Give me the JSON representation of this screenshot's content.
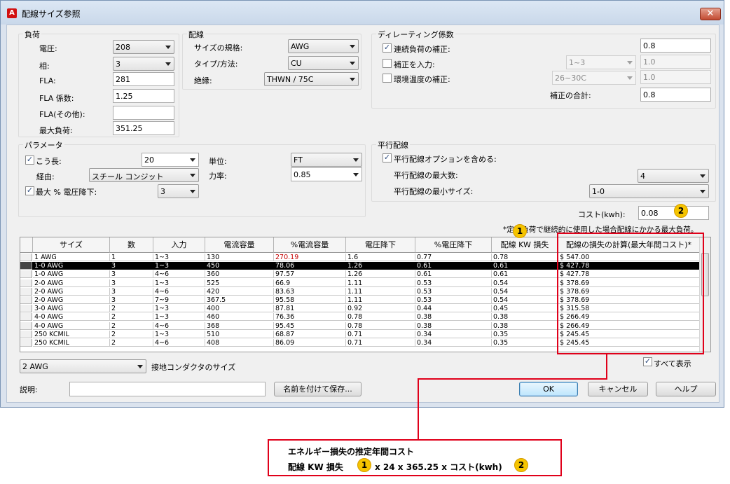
{
  "window": {
    "title": "配線サイズ参照",
    "close_glyph": "✕",
    "app_icon_letter": "A"
  },
  "load": {
    "title": "負荷",
    "voltage_label": "電圧:",
    "voltage_value": "208",
    "phase_label": "相:",
    "phase_value": "3",
    "fla_label": "FLA:",
    "fla_value": "281",
    "fla_factor_label": "FLA 係数:",
    "fla_factor_value": "1.25",
    "fla_other_label": "FLA(その他):",
    "fla_other_value": "",
    "max_load_label": "最大負荷:",
    "max_load_value": "351.25"
  },
  "wiring": {
    "title": "配線",
    "size_std_label": "サイズの規格:",
    "size_std_value": "AWG",
    "type_label": "タイプ/方法:",
    "type_value": "CU",
    "insulation_label": "絶縁:",
    "insulation_value": "THWN / 75C"
  },
  "derating": {
    "title": "ディレーティング係数",
    "continuous_label": "連続負荷の補正:",
    "continuous_checked": true,
    "continuous_value": "0.8",
    "correction_label": "補正を入力:",
    "correction_checked": false,
    "correction_combo": "1~3",
    "correction_value": "1.0",
    "ambient_label": "環境温度の補正:",
    "ambient_checked": false,
    "ambient_combo": "26~30C",
    "ambient_value": "1.0",
    "total_label": "補正の合計:",
    "total_value": "0.8"
  },
  "params": {
    "title": "パラメータ",
    "length_label": "こう長:",
    "length_checked": true,
    "length_value": "20",
    "unit_label": "単位:",
    "unit_value": "FT",
    "route_label": "経由:",
    "route_value": "スチール コンジット",
    "pf_label": "力率:",
    "pf_value": "0.85",
    "vdrop_label": "最大 % 電圧降下:",
    "vdrop_checked": true,
    "vdrop_value": "3"
  },
  "parallel": {
    "title": "平行配線",
    "include_label": "平行配線オプションを含める:",
    "include_checked": true,
    "max_count_label": "平行配線の最大数:",
    "max_count_value": "4",
    "min_size_label": "平行配線の最小サイズ:",
    "min_size_value": "1-0"
  },
  "cost": {
    "label": "コスト(kwh):",
    "value": "0.08",
    "note": "*定格負荷で継続的に使用した場合配線にかかる最大負荷。"
  },
  "table": {
    "columns": [
      "サイズ",
      "数",
      "入力",
      "電流容量",
      "%電流容量",
      "電圧降下",
      "%電圧降下",
      "配線 KW 損失",
      "配線の損失の計算(最大年間コスト)*"
    ],
    "rows": [
      [
        "1 AWG",
        "1",
        "1~3",
        "130",
        "270.19",
        "1.6",
        "0.77",
        "0.78",
        "$ 547.00"
      ],
      [
        "1-0 AWG",
        "3",
        "1~3",
        "450",
        "78.06",
        "1.26",
        "0.61",
        "0.61",
        "$ 427.78"
      ],
      [
        "1-0 AWG",
        "3",
        "4~6",
        "360",
        "97.57",
        "1.26",
        "0.61",
        "0.61",
        "$ 427.78"
      ],
      [
        "2-0 AWG",
        "3",
        "1~3",
        "525",
        "66.9",
        "1.11",
        "0.53",
        "0.54",
        "$ 378.69"
      ],
      [
        "2-0 AWG",
        "3",
        "4~6",
        "420",
        "83.63",
        "1.11",
        "0.53",
        "0.54",
        "$ 378.69"
      ],
      [
        "2-0 AWG",
        "3",
        "7~9",
        "367.5",
        "95.58",
        "1.11",
        "0.53",
        "0.54",
        "$ 378.69"
      ],
      [
        "3-0 AWG",
        "2",
        "1~3",
        "400",
        "87.81",
        "0.92",
        "0.44",
        "0.45",
        "$ 315.58"
      ],
      [
        "4-0 AWG",
        "2",
        "1~3",
        "460",
        "76.36",
        "0.78",
        "0.38",
        "0.38",
        "$ 266.49"
      ],
      [
        "4-0 AWG",
        "2",
        "4~6",
        "368",
        "95.45",
        "0.78",
        "0.38",
        "0.38",
        "$ 266.49"
      ],
      [
        "250 KCMIL",
        "2",
        "1~3",
        "510",
        "68.87",
        "0.71",
        "0.34",
        "0.35",
        "$ 245.45"
      ],
      [
        "250 KCMIL",
        "2",
        "4~6",
        "408",
        "86.09",
        "0.71",
        "0.34",
        "0.35",
        "$ 245.45"
      ]
    ],
    "selected_row": 1,
    "red_cell": "270.19"
  },
  "footer": {
    "ground_value": "2 AWG",
    "ground_label": "接地コンダクタのサイズ",
    "show_all_label": "すべて表示",
    "show_all_checked": true,
    "desc_label": "説明:",
    "desc_value": "",
    "save_label": "名前を付けて保存...",
    "ok_label": "OK",
    "cancel_label": "キャンセル",
    "help_label": "ヘルプ"
  },
  "annotations": {
    "badge1": "1",
    "badge2": "2",
    "callout_title": "エネルギー損失の推定年間コスト",
    "callout_prefix": "配線 KW 損失",
    "callout_mid": "x 24 x 365.25 x コスト(kwh)"
  },
  "colors": {
    "annotation_red": "#e0001a",
    "badge_yellow": "#f5c400",
    "highlight_red_text": "#c40000"
  }
}
